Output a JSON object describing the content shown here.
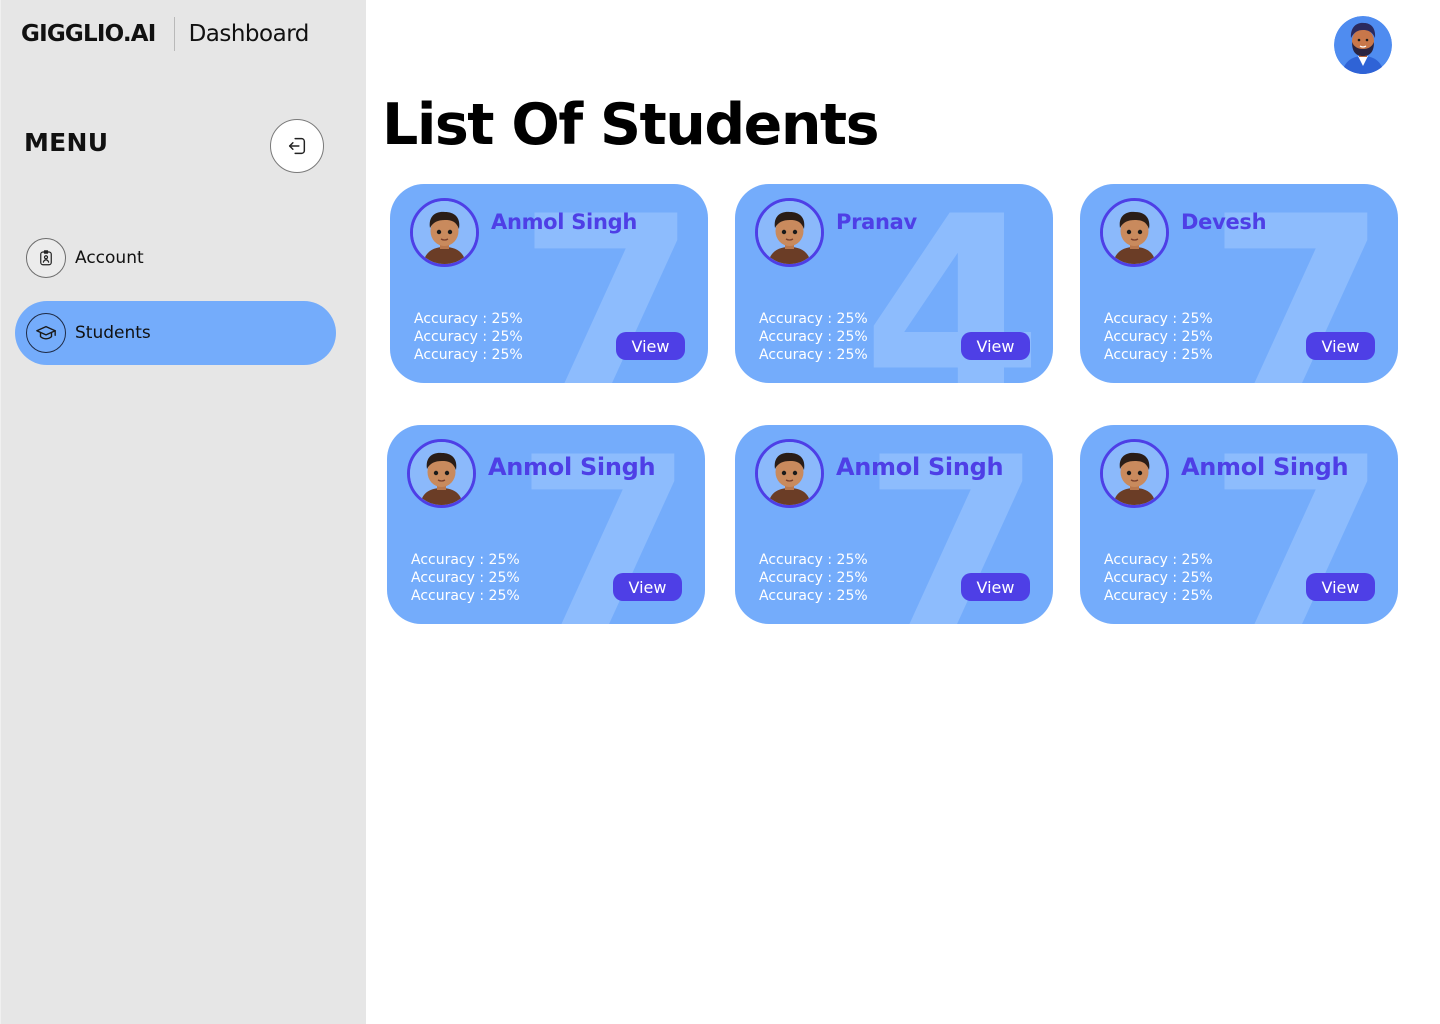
{
  "brand": {
    "logo": "GIGGLIO.AI",
    "section": "Dashboard"
  },
  "sidebar": {
    "menu_title": "MENU",
    "items": [
      {
        "label": "Account",
        "icon": "id-badge-icon",
        "active": false
      },
      {
        "label": "Students",
        "icon": "graduation-cap-icon",
        "active": true
      }
    ]
  },
  "main": {
    "title": "List Of Students",
    "students": [
      {
        "name": "Anmol Singh",
        "bg_digit": "7",
        "stats": [
          "Accuracy : 25%",
          "Accuracy : 25%",
          "Accuracy : 25%"
        ],
        "view_label": "View"
      },
      {
        "name": "Pranav",
        "bg_digit": "4",
        "stats": [
          "Accuracy : 25%",
          "Accuracy : 25%",
          "Accuracy : 25%"
        ],
        "view_label": "View"
      },
      {
        "name": "Devesh",
        "bg_digit": "7",
        "stats": [
          "Accuracy : 25%",
          "Accuracy : 25%",
          "Accuracy : 25%"
        ],
        "view_label": "View"
      },
      {
        "name": "Anmol Singh",
        "bg_digit": "7",
        "stats": [
          "Accuracy : 25%",
          "Accuracy : 25%",
          "Accuracy : 25%"
        ],
        "view_label": "View"
      },
      {
        "name": "Anmol Singh",
        "bg_digit": "7",
        "stats": [
          "Accuracy : 25%",
          "Accuracy : 25%",
          "Accuracy : 25%"
        ],
        "view_label": "View"
      },
      {
        "name": "Anmol Singh",
        "bg_digit": "7",
        "stats": [
          "Accuracy : 25%",
          "Accuracy : 25%",
          "Accuracy : 25%"
        ],
        "view_label": "View"
      }
    ]
  },
  "colors": {
    "sidebar_bg": "#e6e6e6",
    "accent_blue": "#74acfb",
    "brand_purple": "#4e3fe6",
    "card_digit": "#8dbcfd"
  }
}
